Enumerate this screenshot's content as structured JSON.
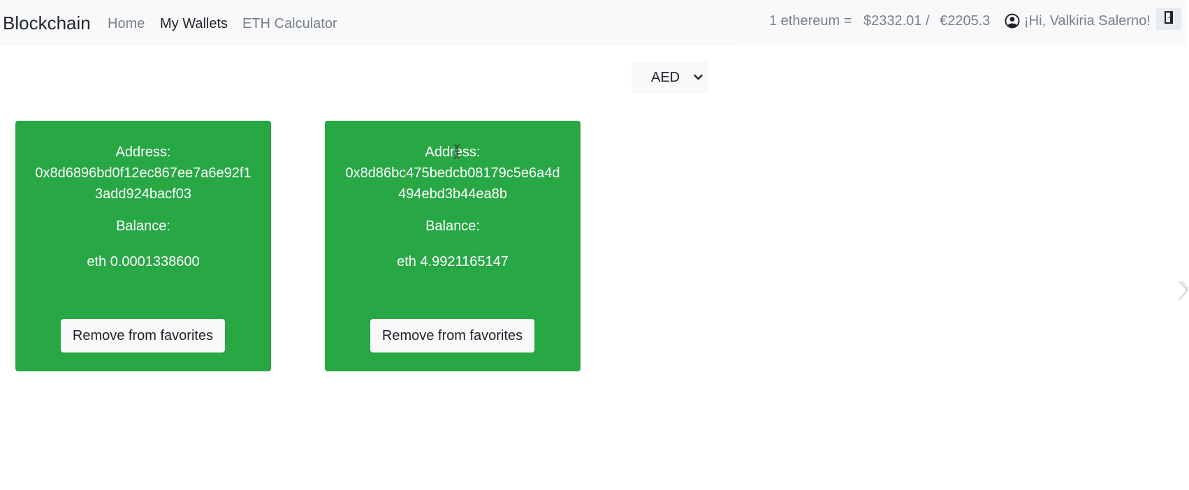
{
  "navbar": {
    "brand": "Blockchain",
    "links": [
      {
        "label": "Home",
        "active": false
      },
      {
        "label": "My Wallets",
        "active": true
      },
      {
        "label": "ETH Calculator",
        "active": false
      }
    ],
    "rate": {
      "prefix": "1 ethereum =",
      "usd": "$2332.01 /",
      "eur": "€2205.3"
    },
    "user_greeting": "¡Hi, Valkiria Salerno!",
    "icons": {
      "user": "user-circle-icon",
      "logout": "door-exit-icon"
    }
  },
  "currency_select": {
    "selected": "AED",
    "icon": "chevron-down-icon"
  },
  "wallets": [
    {
      "address_label": "Address:",
      "address": "0x8d6896bd0f12ec867ee7a6e92f13add924bacf03",
      "balance_label": "Balance:",
      "balance": "eth 0.0001338600",
      "action_label": "Remove from favorites"
    },
    {
      "address_label": "Address:",
      "address": "0x8d86bc475bedcb08179c5e6a4d494ebd3b44ea8b",
      "balance_label": "Balance:",
      "balance": "eth 4.9921165147",
      "action_label": "Remove from favorites"
    }
  ],
  "colors": {
    "card_background": "#28a745",
    "navbar_background": "#f8f9fa",
    "muted_text": "#7a7f85"
  }
}
